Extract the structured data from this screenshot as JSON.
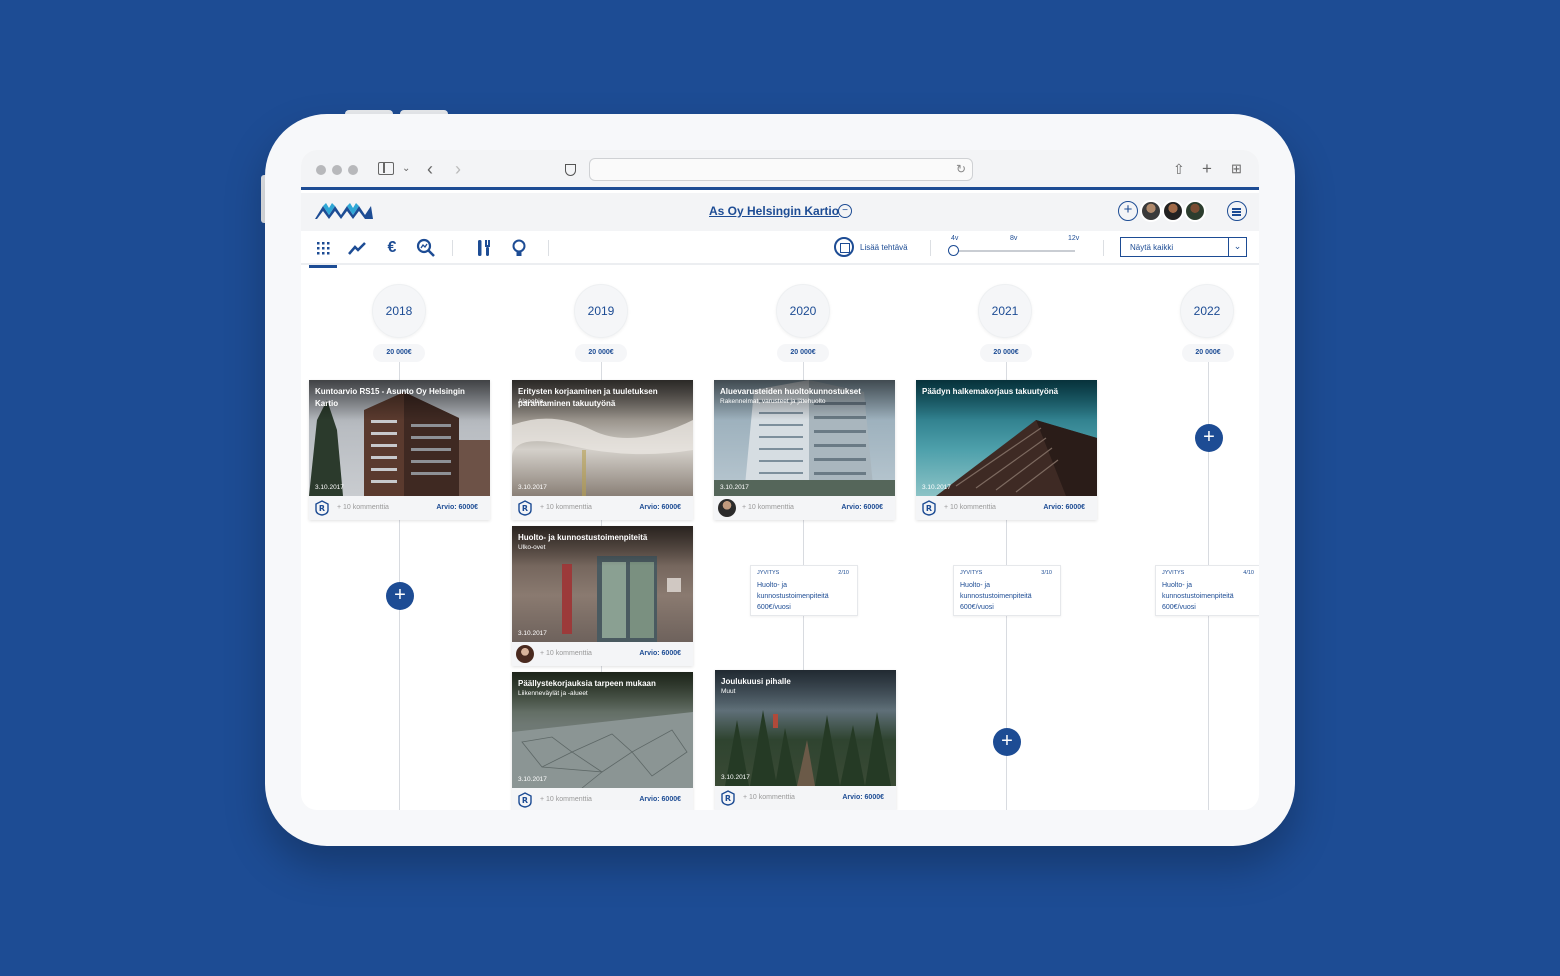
{
  "app": {
    "title": "As Oy Helsingin Kartio",
    "toggle_symbol": "−",
    "add_user_symbol": "+"
  },
  "colors": {
    "brand": "#1d4c94",
    "background": "#1d4c94"
  },
  "toolbar": {
    "tools": [
      "grid-icon",
      "trend-icon",
      "euro-icon",
      "search-analytics-icon",
      "tools-icon",
      "lightbulb-icon"
    ],
    "euro_symbol": "€",
    "add_task_label": "Lisää tehtävä",
    "range_labels": [
      "4v",
      "8v",
      "12v"
    ],
    "filter_value": "Näytä kaikki",
    "filter_caret": "⌄"
  },
  "plus_symbol": "+",
  "years": [
    {
      "label": "2018",
      "budget": "20 000€"
    },
    {
      "label": "2019",
      "budget": "20 000€"
    },
    {
      "label": "2020",
      "budget": "20 000€"
    },
    {
      "label": "2021",
      "budget": "20 000€"
    },
    {
      "label": "2022",
      "budget": "20 000€"
    }
  ],
  "cards": [
    {
      "title": "Kuntoarvio RS15 - Asunto Oy Helsingin Kartio",
      "subtitle": "",
      "date": "3.10.2017",
      "comments": "+ 10 kommenttia",
      "estimate": "Arvio: 6000€"
    },
    {
      "title": "Eritysten korjaaminen ja tuuletuksen parantaminen takuutyönä",
      "subtitle": "Alapohja",
      "date": "3.10.2017",
      "comments": "+ 10 kommenttia",
      "estimate": "Arvio: 6000€"
    },
    {
      "title": "Aluevarusteiden huoltokunnostukset",
      "subtitle": "Rakennelmat, varusteet ja jätehuolto",
      "date": "3.10.2017",
      "comments": "+ 10 kommenttia",
      "estimate": "Arvio: 6000€"
    },
    {
      "title": "Päädyn halkemakorjaus takuutyönä",
      "subtitle": "",
      "date": "3.10.2017",
      "comments": "+ 10 kommenttia",
      "estimate": "Arvio: 6000€"
    },
    {
      "title": "Huolto- ja kunnostustoimenpiteitä",
      "subtitle": "Ulko-ovet",
      "date": "3.10.2017",
      "comments": "+ 10 kommenttia",
      "estimate": "Arvio: 6000€"
    },
    {
      "title": "Päällystekorjauksia tarpeen mukaan",
      "subtitle": "Liikenneväylät ja -alueet",
      "date": "3.10.2017",
      "comments": "+ 10 kommenttia",
      "estimate": "Arvio: 6000€"
    },
    {
      "title": "Joulukuusi pihalle",
      "subtitle": "Muut",
      "date": "3.10.2017",
      "comments": "+ 10 kommenttia",
      "estimate": "Arvio: 6000€"
    }
  ],
  "mini_cards": [
    {
      "kind": "JYVITYS",
      "count": "2/10",
      "body": "Huolto- ja kunnostustoimenpiteitä 600€/vuosi"
    },
    {
      "kind": "JYVITYS",
      "count": "3/10",
      "body": "Huolto- ja kunnostustoimenpiteitä 600€/vuosi"
    },
    {
      "kind": "JYVITYS",
      "count": "4/10",
      "body": "Huolto- ja kunnostustoimenpiteitä 600€/vuosi"
    }
  ]
}
